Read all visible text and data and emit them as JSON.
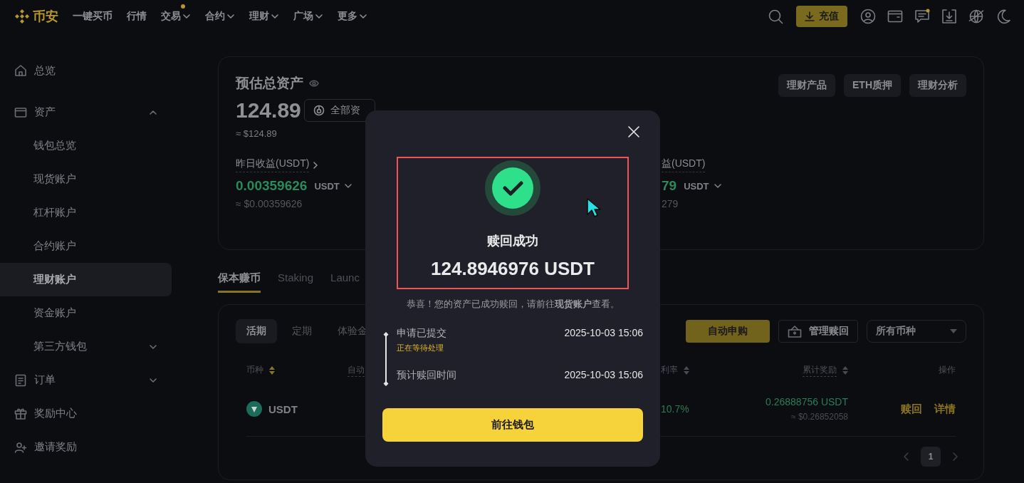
{
  "nav": {
    "logo": "币安",
    "items": [
      {
        "label": "一键买币",
        "menu": false,
        "dot": false
      },
      {
        "label": "行情",
        "menu": false,
        "dot": false
      },
      {
        "label": "交易",
        "menu": true,
        "dot": true
      },
      {
        "label": "合约",
        "menu": true,
        "dot": false
      },
      {
        "label": "理财",
        "menu": true,
        "dot": false
      },
      {
        "label": "广场",
        "menu": true,
        "dot": false
      },
      {
        "label": "更多",
        "menu": true,
        "dot": false
      }
    ],
    "deposit": "充值",
    "messages_dot": true
  },
  "sidebar": [
    {
      "label": "总览",
      "kind": "item",
      "selected": false
    },
    {
      "label": "资产",
      "kind": "group",
      "expanded": true,
      "children": [
        {
          "label": "钱包总览",
          "selected": false
        },
        {
          "label": "现货账户",
          "selected": false
        },
        {
          "label": "杠杆账户",
          "selected": false
        },
        {
          "label": "合约账户",
          "selected": false
        },
        {
          "label": "理财账户",
          "selected": true
        },
        {
          "label": "资金账户",
          "selected": false
        },
        {
          "label": "第三方钱包",
          "selected": false,
          "expanded": false
        }
      ]
    },
    {
      "label": "订单",
      "kind": "group",
      "expanded": false
    },
    {
      "label": "奖励中心",
      "kind": "item",
      "selected": false
    },
    {
      "label": "邀请奖励",
      "kind": "item",
      "selected": false
    }
  ],
  "summary": {
    "title": "预估总资产",
    "total": "124.89",
    "all_assets_button": "全部资",
    "usd": "≈ $124.89",
    "stats": [
      {
        "label": "昨日收益(USDT)",
        "link": true,
        "value": "0.00359626",
        "unit": "USDT",
        "usd": "≈ $0.00359626"
      },
      {
        "label": "益(USDT)",
        "link": false,
        "value": "79",
        "unit": "USDT",
        "usd": "279"
      }
    ],
    "actions": [
      "理财产品",
      "ETH质押",
      "理财分析"
    ]
  },
  "product_tabs": [
    {
      "label": "保本赚币",
      "selected": true
    },
    {
      "label": "Staking",
      "selected": false
    },
    {
      "label": "Launc",
      "selected": false
    }
  ],
  "earn": {
    "subtabs": [
      {
        "label": "活期",
        "selected": true
      },
      {
        "label": "定期",
        "selected": false
      },
      {
        "label": "体验金",
        "selected": false
      }
    ],
    "auto_button": "自动申购",
    "manage_button": "管理赎回",
    "coin_select": "所有币种",
    "columns": [
      {
        "label": "币种",
        "sortable": true
      },
      {
        "label": "自动",
        "sortable": false
      },
      {
        "label": "利率",
        "sortable": true
      },
      {
        "label": "累计奖励",
        "sortable": true
      },
      {
        "label": "操作",
        "sortable": false
      }
    ],
    "rows": [
      {
        "coin": "USDT",
        "rate": "10.7%",
        "reward": "0.26888756 USDT",
        "reward_usd": "≈ $0.26852058",
        "actions": [
          "赎回",
          "详情"
        ]
      }
    ],
    "pages": [
      {
        "label": "1",
        "selected": true
      }
    ]
  },
  "modal": {
    "title": "赎回成功",
    "amount": "124.8946976 USDT",
    "message": "恭喜！您的资产已成功赎回，请前往**现货账户**查看。",
    "steps": [
      {
        "label": "申请已提交",
        "note": "正在等待处理",
        "time": "2025-10-03 15:06"
      },
      {
        "label": "预计赎回时间",
        "time": "2025-10-03 15:06"
      }
    ],
    "button": "前往钱包"
  }
}
